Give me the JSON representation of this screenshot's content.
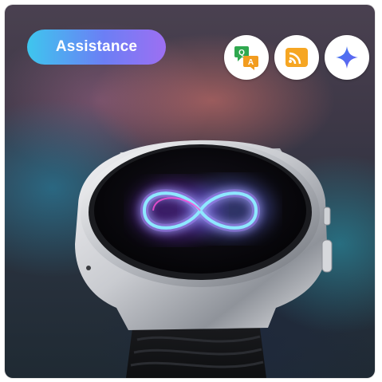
{
  "badge": {
    "label": "Assistance",
    "gradient": [
      "#3ec6ee",
      "#6b7ff5",
      "#9d6ff2"
    ]
  },
  "icons": [
    {
      "name": "qa-chat-icon",
      "colors": [
        "#2fa84f",
        "#f29c1f",
        "#ffffff"
      ]
    },
    {
      "name": "cast-signal-icon",
      "colors": [
        "#f6a623"
      ]
    },
    {
      "name": "sparkle-star-icon",
      "colors": [
        "#3d7df0",
        "#6a5cf0"
      ]
    }
  ],
  "screen": {
    "glow_colors": [
      "#8ee8ff",
      "#b56bff",
      "#ff4fd8"
    ]
  }
}
